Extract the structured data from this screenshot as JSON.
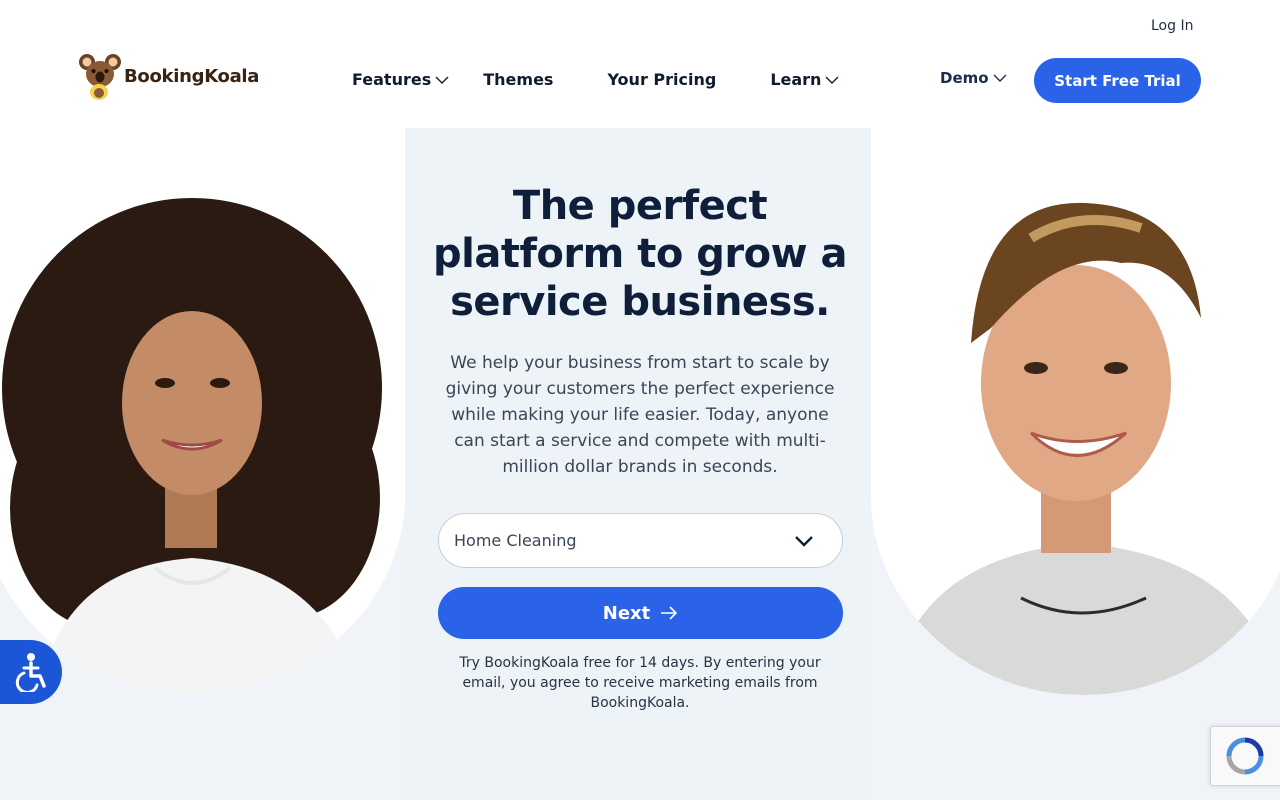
{
  "header": {
    "login_label": "Log In",
    "brand_name": "BookingKoala",
    "nav": [
      {
        "label": "Features",
        "has_dropdown": true
      },
      {
        "label": "Themes",
        "has_dropdown": false
      },
      {
        "label": "Your Pricing",
        "has_dropdown": false
      },
      {
        "label": "Learn",
        "has_dropdown": true
      }
    ],
    "demo_label": "Demo",
    "cta_label": "Start Free Trial"
  },
  "hero": {
    "title": "The perfect platform to grow a service business.",
    "description": "We help your business from start to scale by giving your customers the perfect experience while making your life easier. Today, anyone can start a service and compete with multi-million dollar brands in seconds.",
    "service_select": {
      "selected": "Home Cleaning"
    },
    "next_label": "Next",
    "disclaimer": "Try BookingKoala free for 14 days. By entering your email, you agree to receive marketing emails from BookingKoala."
  },
  "colors": {
    "primary": "#2a63e8",
    "heading": "#0f1f3a",
    "hero_background": "#f0f4f9",
    "accessibility": "#1b56d6",
    "logo_text": "#3a2212"
  },
  "icons": {
    "logo": "koala-logo-icon",
    "dropdown": "chevron-down-icon",
    "next": "arrow-right-icon",
    "accessibility": "accessibility-icon",
    "recaptcha": "recaptcha-icon"
  }
}
